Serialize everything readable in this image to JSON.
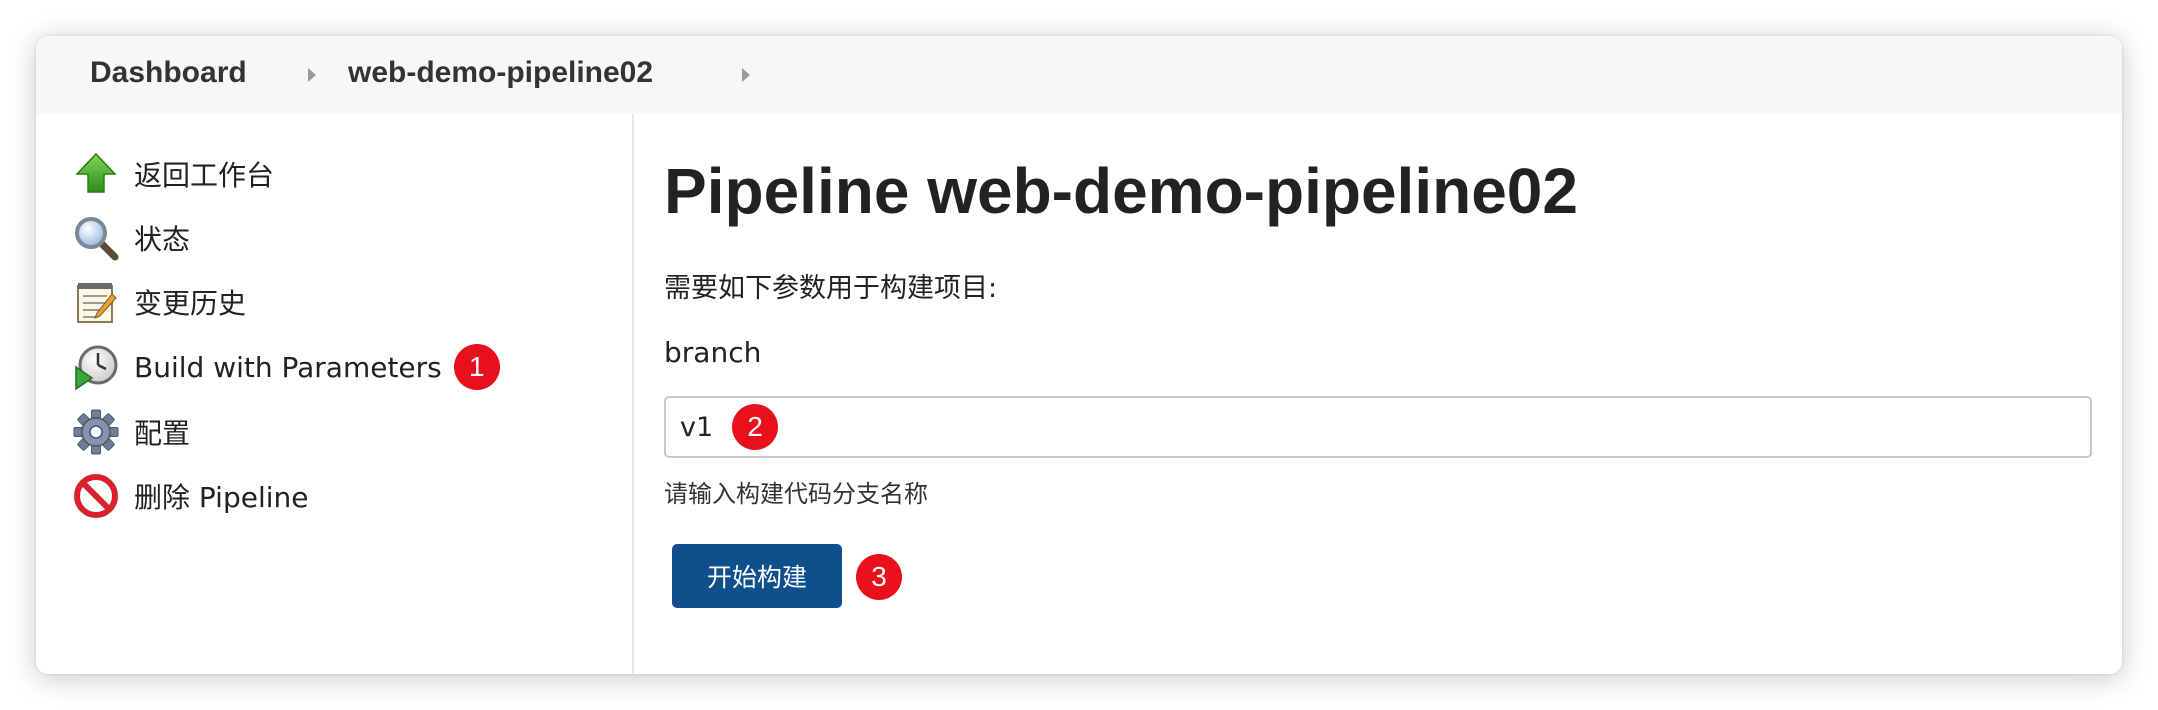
{
  "breadcrumb": {
    "items": [
      "Dashboard",
      "web-demo-pipeline02"
    ]
  },
  "sidebar": {
    "items": [
      {
        "label": "返回工作台",
        "icon": "up-arrow-icon"
      },
      {
        "label": "状态",
        "icon": "magnifier-icon"
      },
      {
        "label": "变更历史",
        "icon": "notepad-icon"
      },
      {
        "label": "Build with Parameters",
        "icon": "clock-play-icon",
        "callout": "1"
      },
      {
        "label": "配置",
        "icon": "gear-icon"
      },
      {
        "label": "删除 Pipeline",
        "icon": "no-entry-icon"
      }
    ]
  },
  "main": {
    "title": "Pipeline web-demo-pipeline02",
    "intro": "需要如下参数用于构建项目:",
    "param": {
      "name": "branch",
      "value": "v1",
      "description": "请输入构建代码分支名称",
      "callout": "2"
    },
    "build_button": {
      "label": "开始构建",
      "callout": "3"
    }
  },
  "colors": {
    "accent": "#0f4f8c",
    "callout": "#e8101a",
    "topbar": "#f7f7f7"
  }
}
